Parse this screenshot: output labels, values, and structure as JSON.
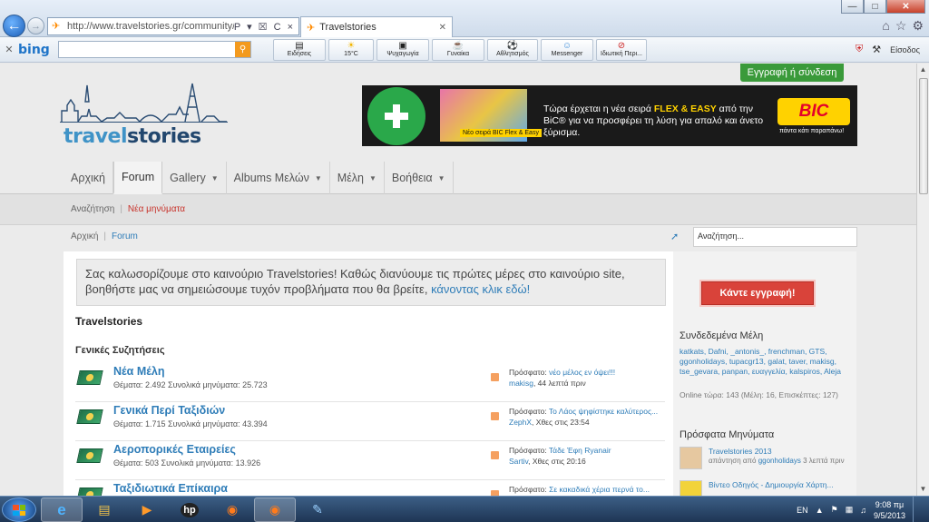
{
  "browser": {
    "url": "http://www.travelstories.gr/community/",
    "tab_title": "Travelstories",
    "url_icons": "P ▾ ☒ C ×"
  },
  "toolbar": {
    "search_engine": "bing",
    "items": [
      {
        "label": "Ειδήσεις",
        "icon": "newspaper-icon"
      },
      {
        "label": "15°C",
        "icon": "weather-icon"
      },
      {
        "label": "Ψυχαγωγία",
        "icon": "film-icon"
      },
      {
        "label": "Γυναίκα",
        "icon": "cup-icon"
      },
      {
        "label": "Αθλητισμός",
        "icon": "ball-icon"
      },
      {
        "label": "Messenger",
        "icon": "messenger-icon"
      },
      {
        "label": "Ιδιωτική Περι...",
        "icon": "private-icon"
      }
    ],
    "signin": "Είσοδος"
  },
  "site": {
    "register_top": "Εγγραφή ή σύνδεση",
    "logo_part1": "travel",
    "logo_part2": "stories"
  },
  "banner": {
    "badge_text": "ΑΠΟΚΛΕΙΣΤΙΚΑ ΣΤΑ ΦΑΡΜΑΚΕΙΑ",
    "product_label": "Νέο σειρά BIC Flex & Easy",
    "text_pre": "Τώρα έρχεται η νέα σειρά ",
    "text_brand": "FLEX & EASY",
    "text_post": " από την BiC® για να προσφέρει τη λύση για απαλό και άνετο ξύρισμα.",
    "logo": "BIC",
    "slogan": "πάντα κάτι παραπάνω!"
  },
  "nav": {
    "items": [
      {
        "label": "Αρχική",
        "caret": false
      },
      {
        "label": "Forum",
        "caret": false
      },
      {
        "label": "Gallery",
        "caret": true
      },
      {
        "label": "Albums Μελών",
        "caret": true
      },
      {
        "label": "Μέλη",
        "caret": true
      },
      {
        "label": "Βοήθεια",
        "caret": true
      }
    ],
    "sub_search": "Αναζήτηση",
    "sub_new": "Νέα μηνύματα"
  },
  "crumb": {
    "home": "Αρχική",
    "current": "Forum"
  },
  "search_box": "Αναζήτηση...",
  "welcome": {
    "text": "Σας καλωσορίζουμε στο καινούριο Travelstories! Καθώς διανύουμε τις πρώτες μέρες στο καινούριο site, βοηθήστε μας να σημειώσουμε τυχόν προβλήματα που θα βρείτε, ",
    "link": "κάνοντας κλικ εδώ!"
  },
  "forum": {
    "title": "Travelstories",
    "section": "Γενικές Συζητήσεις",
    "rows": [
      {
        "name": "Νέα Μέλη",
        "stats": "Θέματα: 2.492 Συνολικά μηνύματα: 25.723",
        "latest_label": "Πρόσφατο: ",
        "latest_title": "νέο μέλος εν όψει!!!",
        "latest_user": "makisg",
        "latest_time": ", 44 λεπτά πριν"
      },
      {
        "name": "Γενικά Περί Ταξιδιών",
        "stats": "Θέματα: 1.715 Συνολικά μηνύματα: 43.394",
        "latest_label": "Πρόσφατο: ",
        "latest_title": "Το Λάος ψηφίστηκε καλύτερος...",
        "latest_user": "ZephX",
        "latest_time": ", Χθες στις 23:54"
      },
      {
        "name": "Αεροπορικές Εταιρείες",
        "stats": "Θέματα: 503 Συνολικά μηνύματα: 13.926",
        "latest_label": "Πρόσφατο: ",
        "latest_title": "Τάδε Έφη Ryanair",
        "latest_user": "Sartiv",
        "latest_time": ", Χθες στις 20:16"
      },
      {
        "name": "Ταξιδιωτικά Επίκαιρα",
        "stats": "",
        "latest_label": "Πρόσφατο: ",
        "latest_title": "Σε κακαδικά χέρια περνά το...",
        "latest_user": "",
        "latest_time": ""
      }
    ]
  },
  "sidebar": {
    "register_button": "Κάντε εγγραφή!",
    "online_title": "Συνδεδεμένα Μέλη",
    "online_users": "katkats, Dafni, _antonis_, frenchman, GTS, ggonholidays, tupacgr13, galat, taver, makisg, tse_gevara, panpan, ευαγγελία, kalspiros, Aleja",
    "online_count": "Online τώρα: 143 (Μέλη: 16, Επισκέπτες: 127)",
    "recent_title": "Πρόσφατα Μηνύματα",
    "recent": [
      {
        "title": "Travelstories 2013",
        "meta_pre": "απάντηση από ",
        "user": "ggonholidays",
        "meta_post": " 3 λεπτά πριν"
      },
      {
        "title": "Βίντεο Οδηγός - Δημιουργία Χάρτη...",
        "meta_pre": "",
        "user": "",
        "meta_post": ""
      }
    ]
  },
  "taskbar": {
    "lang": "EN",
    "time": "9:08 πμ",
    "date": "9/5/2013"
  }
}
